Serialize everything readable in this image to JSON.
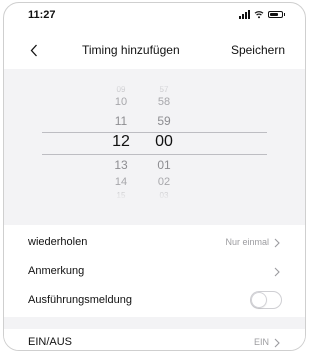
{
  "status_bar": {
    "time": "11:27"
  },
  "nav": {
    "back_icon": "chevron-left-icon",
    "title": "Timing hinzufügen",
    "save_label": "Speichern"
  },
  "picker": {
    "hours": [
      "09",
      "10",
      "11",
      "12",
      "13",
      "14",
      "15"
    ],
    "minutes": [
      "57",
      "58",
      "59",
      "00",
      "01",
      "02",
      "03"
    ],
    "selected_hour": "12",
    "selected_minute": "00"
  },
  "settings": {
    "repeat": {
      "label": "wiederholen",
      "value": "Nur einmal"
    },
    "note": {
      "label": "Anmerkung"
    },
    "execution_notice": {
      "label": "Ausführungsmeldung",
      "enabled": false
    },
    "power": {
      "label": "EIN/AUS",
      "value": "EIN"
    }
  },
  "colors": {
    "background": "#ffffff",
    "section_gray": "#f3f3f5",
    "muted_text": "#9c9ca0"
  }
}
